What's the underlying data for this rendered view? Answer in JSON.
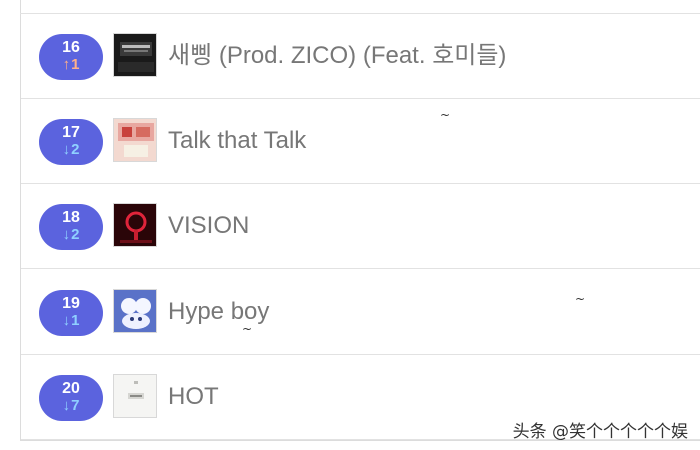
{
  "chart_list": {
    "rows": [
      {
        "rank": "16",
        "change": "1",
        "direction": "up",
        "arrow": "↑",
        "title": "새삥 (Prod. ZICO) (Feat. 호미들)",
        "cover_icon": "album-cover-seesaw"
      },
      {
        "rank": "17",
        "change": "2",
        "direction": "down",
        "arrow": "↓",
        "title": "Talk that Talk",
        "cover_icon": "album-cover-talk-that-talk"
      },
      {
        "rank": "18",
        "change": "2",
        "direction": "down",
        "arrow": "↓",
        "title": "VISION",
        "cover_icon": "album-cover-vision"
      },
      {
        "rank": "19",
        "change": "1",
        "direction": "down",
        "arrow": "↓",
        "title": "Hype boy",
        "cover_icon": "album-cover-hype-boy"
      },
      {
        "rank": "20",
        "change": "7",
        "direction": "down",
        "arrow": "↓",
        "title": "HOT",
        "cover_icon": "album-cover-hot"
      }
    ]
  },
  "watermark": {
    "text": "头条 @笑个个个个个娱"
  },
  "colors": {
    "rank_pill": "#5b63de",
    "change_up": "#ffb08a",
    "change_down": "#8fd0ff",
    "title_text": "#777777"
  }
}
